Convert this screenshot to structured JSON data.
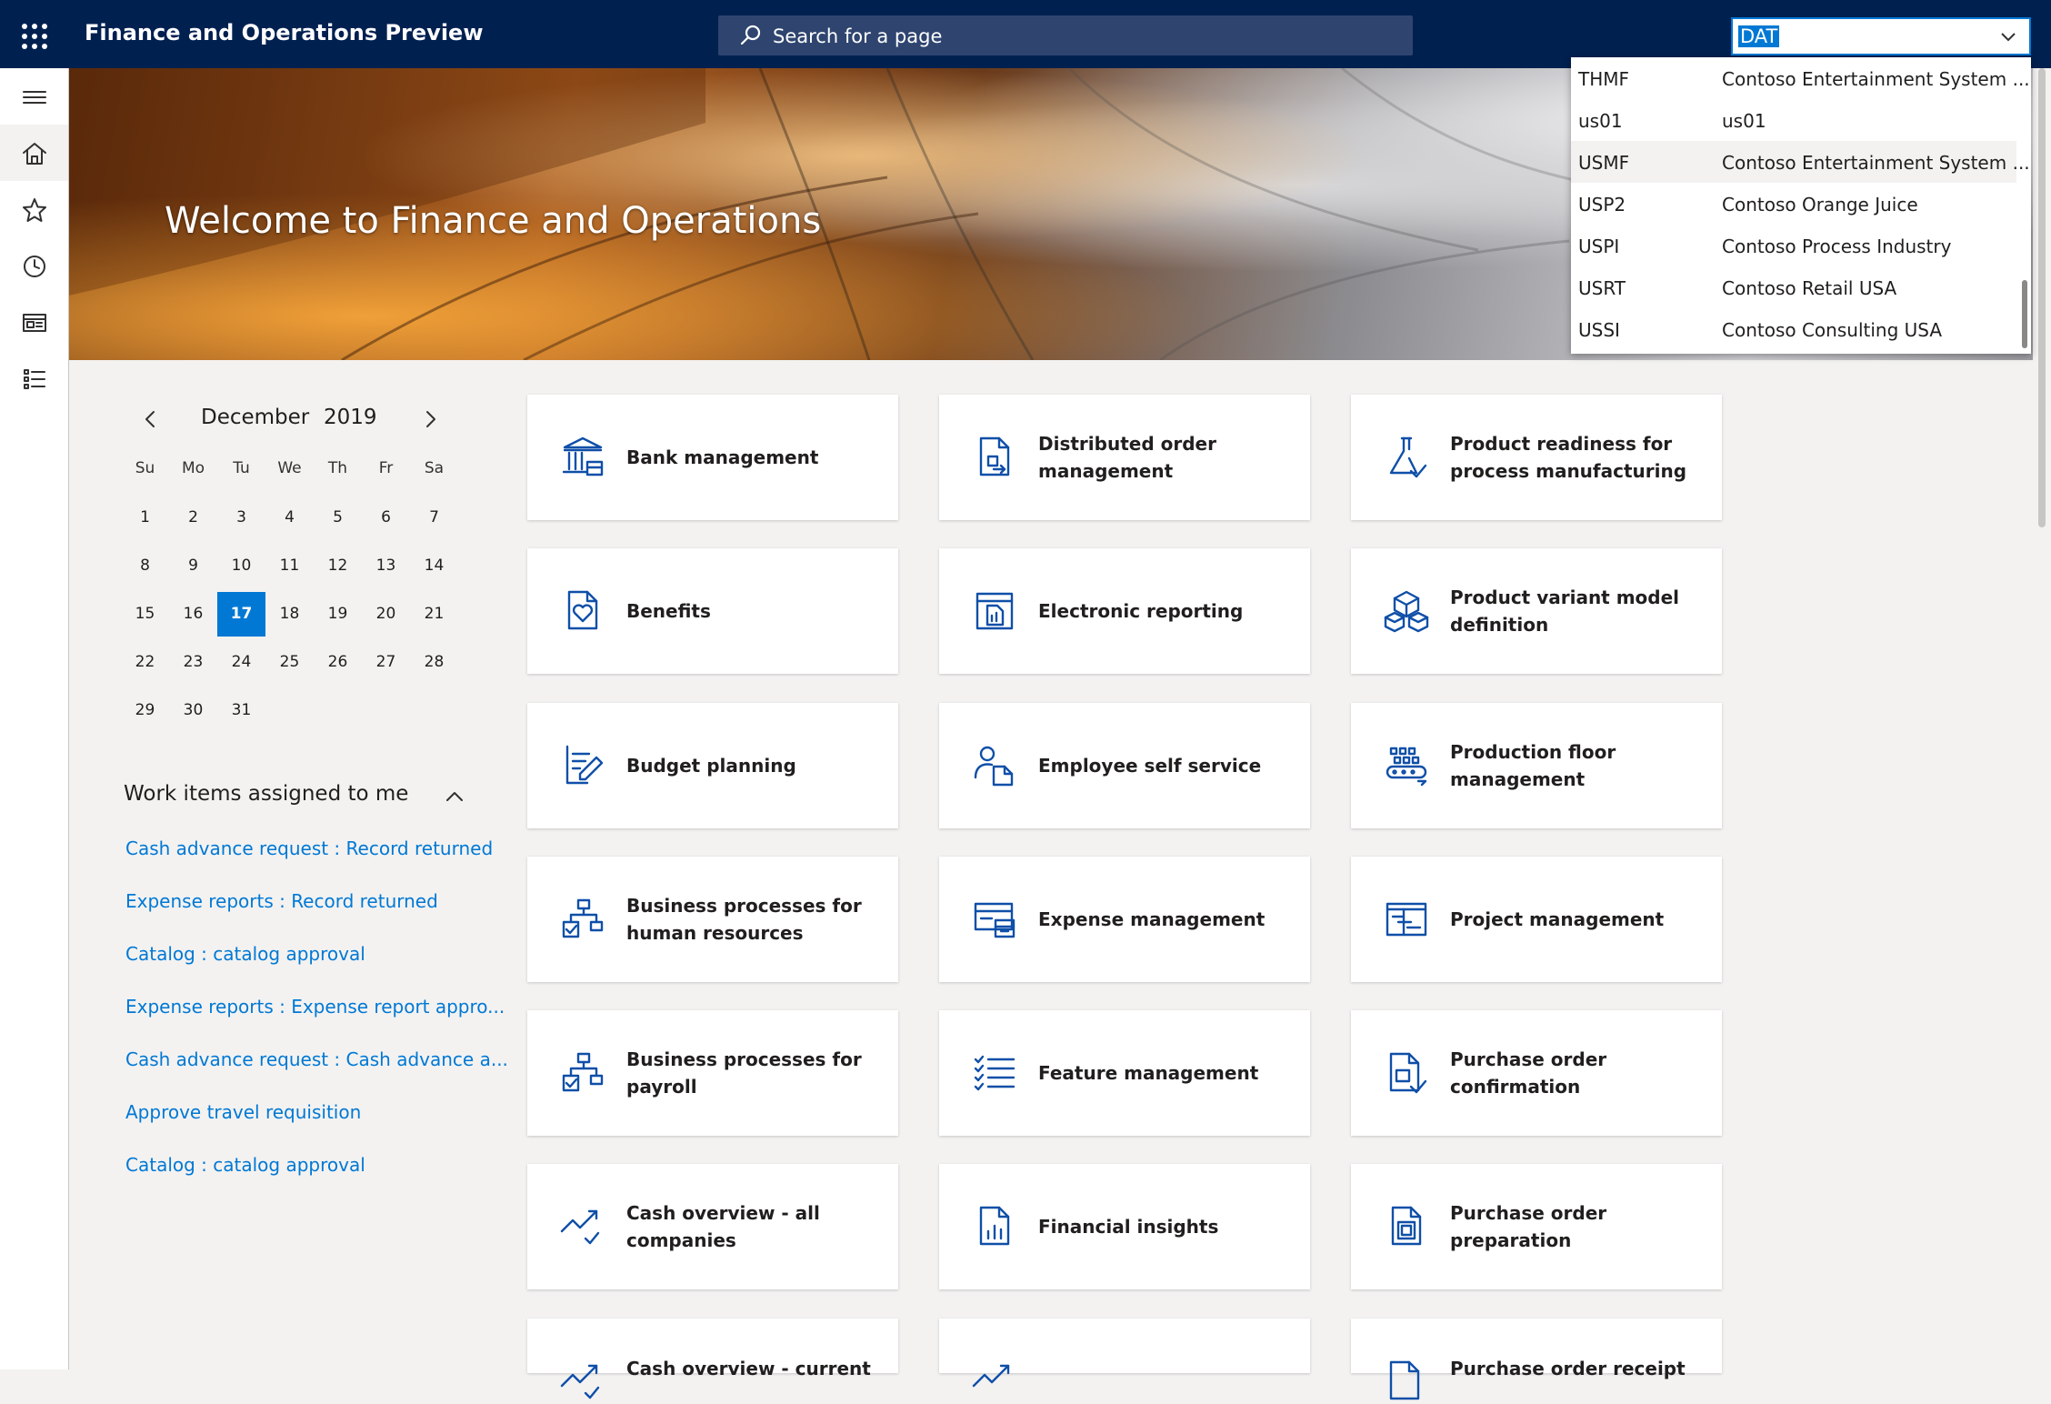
{
  "app": {
    "title": "Finance and Operations Preview"
  },
  "search": {
    "placeholder": "Search for a page"
  },
  "company_picker": {
    "value": "DAT",
    "options": [
      {
        "code": "THMF",
        "name": "Contoso Entertainment System ..."
      },
      {
        "code": "us01",
        "name": "us01"
      },
      {
        "code": "USMF",
        "name": "Contoso Entertainment System ..."
      },
      {
        "code": "USP2",
        "name": "Contoso Orange Juice"
      },
      {
        "code": "USPI",
        "name": "Contoso Process Industry"
      },
      {
        "code": "USRT",
        "name": "Contoso Retail USA"
      },
      {
        "code": "USSI",
        "name": "Contoso Consulting USA"
      }
    ]
  },
  "banner": {
    "title": "Welcome to Finance and Operations"
  },
  "calendar": {
    "month": "December",
    "year": "2019",
    "weekdays": [
      "Su",
      "Mo",
      "Tu",
      "We",
      "Th",
      "Fr",
      "Sa"
    ],
    "selected_day": "17",
    "weeks": [
      [
        "1",
        "2",
        "3",
        "4",
        "5",
        "6",
        "7"
      ],
      [
        "8",
        "9",
        "10",
        "11",
        "12",
        "13",
        "14"
      ],
      [
        "15",
        "16",
        "17",
        "18",
        "19",
        "20",
        "21"
      ],
      [
        "22",
        "23",
        "24",
        "25",
        "26",
        "27",
        "28"
      ],
      [
        "29",
        "30",
        "31"
      ]
    ]
  },
  "work_items": {
    "title": "Work items assigned to me",
    "items": [
      "Cash advance request : Record returned",
      "Expense reports : Record returned",
      "Catalog : catalog approval",
      "Expense reports : Expense report appro...",
      "Cash advance request : Cash advance a...",
      "Approve travel requisition",
      "Catalog : catalog approval"
    ]
  },
  "tiles": [
    {
      "label": "Bank management",
      "icon": "bank-icon"
    },
    {
      "label": "Distributed order management",
      "icon": "order-document-icon"
    },
    {
      "label": "Product readiness for process manufacturing",
      "icon": "flask-check-icon"
    },
    {
      "label": "Benefits",
      "icon": "heart-document-icon"
    },
    {
      "label": "Electronic reporting",
      "icon": "report-icon"
    },
    {
      "label": "Product variant model definition",
      "icon": "boxes-icon"
    },
    {
      "label": "Budget planning",
      "icon": "pen-list-icon"
    },
    {
      "label": "Employee self service",
      "icon": "person-document-icon"
    },
    {
      "label": "Production floor management",
      "icon": "conveyor-icon"
    },
    {
      "label": "Business processes for human resources",
      "icon": "process-check-icon"
    },
    {
      "label": "Expense management",
      "icon": "card-icon"
    },
    {
      "label": "Project management",
      "icon": "project-icon"
    },
    {
      "label": "Business processes for payroll",
      "icon": "process-check-icon"
    },
    {
      "label": "Feature management",
      "icon": "checklist-icon"
    },
    {
      "label": "Purchase order confirmation",
      "icon": "po-check-icon"
    },
    {
      "label": "Cash overview - all companies",
      "icon": "trend-check-icon"
    },
    {
      "label": "Financial insights",
      "icon": "bar-chart-document-icon"
    },
    {
      "label": "Purchase order preparation",
      "icon": "po-prep-icon"
    },
    {
      "label": "Cash overview - current",
      "icon": "trend-check-icon"
    },
    {
      "label": "",
      "icon": "trend-icon"
    },
    {
      "label": "Purchase order receipt and",
      "icon": "po-receipt-icon"
    }
  ],
  "nav": {
    "items": [
      "hamburger-icon",
      "home-icon",
      "star-icon",
      "clock-icon",
      "workspace-icon",
      "list-icon"
    ]
  }
}
